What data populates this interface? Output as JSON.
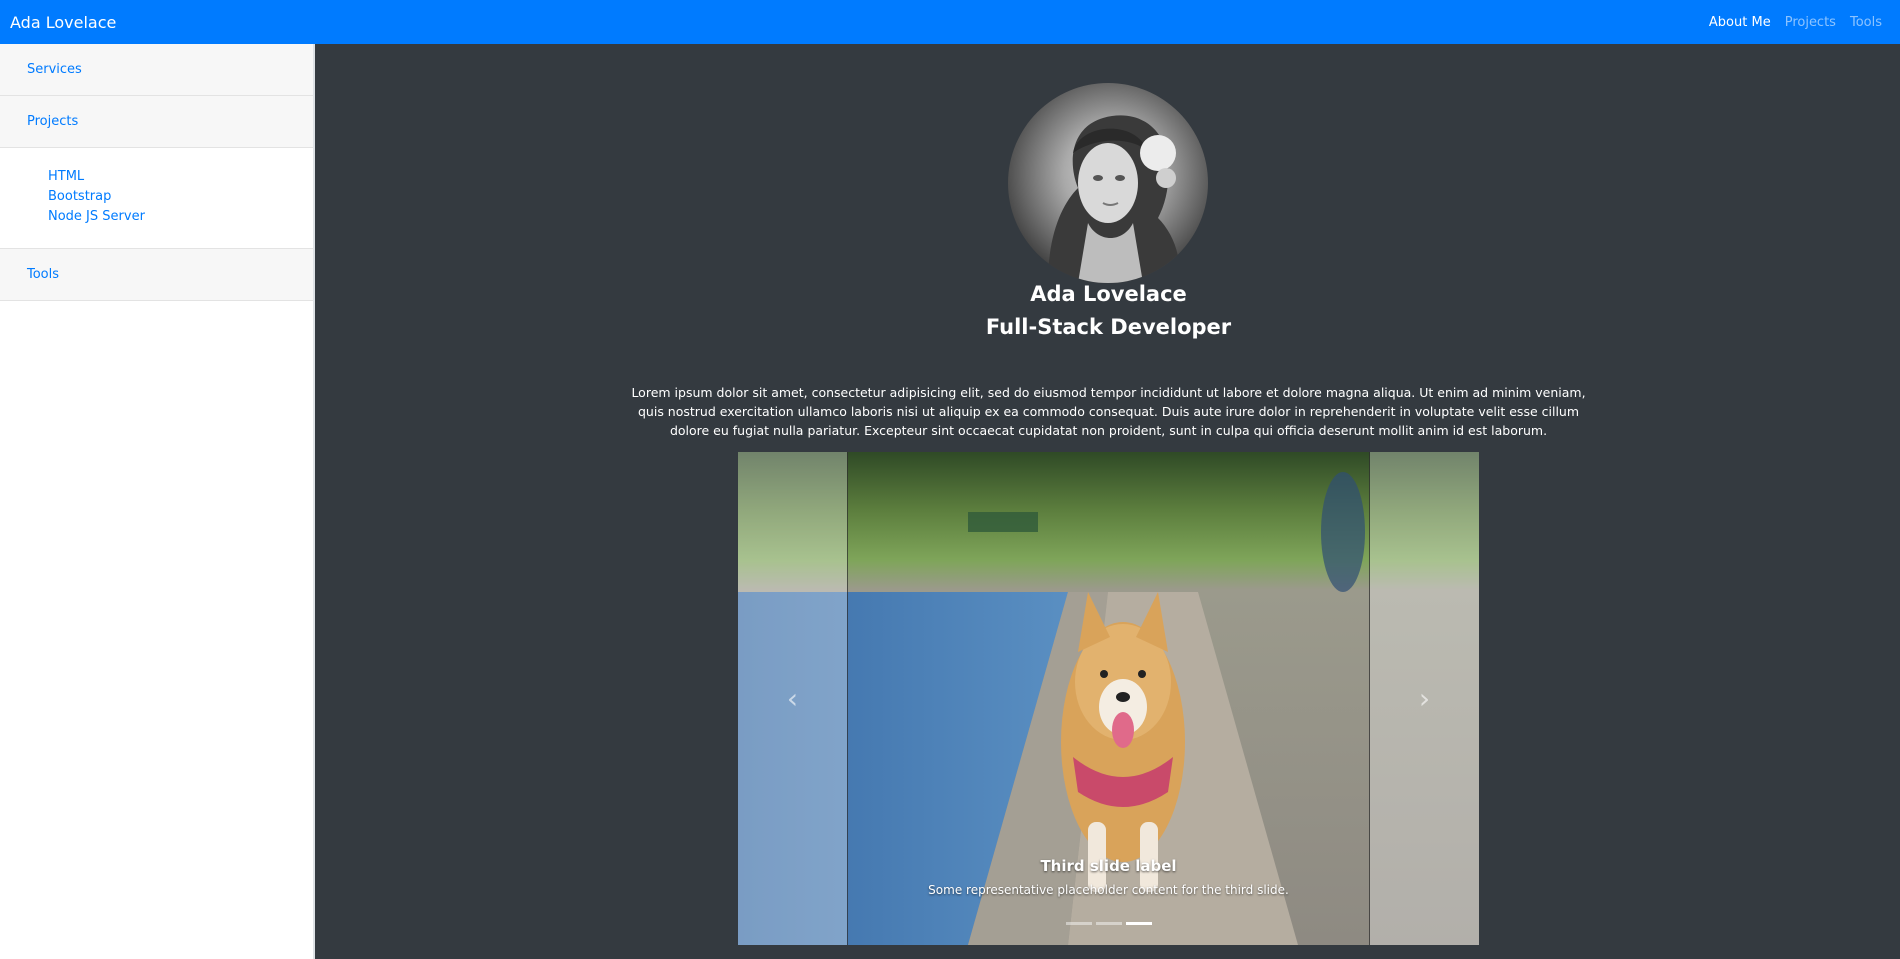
{
  "navbar": {
    "brand": "Ada Lovelace",
    "links": [
      {
        "label": "About Me",
        "active": true
      },
      {
        "label": "Projects",
        "active": false
      },
      {
        "label": "Tools",
        "active": false
      }
    ]
  },
  "sidebar": {
    "items": [
      "Services",
      "Projects",
      "Tools"
    ],
    "projects_sub": [
      "HTML",
      "Bootstrap",
      "Node JS Server"
    ]
  },
  "profile": {
    "name": "Ada Lovelace",
    "role": "Full-Stack Developer",
    "bio": "Lorem ipsum dolor sit amet, consectetur adipisicing elit, sed do eiusmod tempor incididunt ut labore et dolore magna aliqua. Ut enim ad minim veniam, quis nostrud exercitation ullamco laboris nisi ut aliquip ex ea commodo consequat. Duis aute irure dolor in reprehenderit in voluptate velit esse cillum dolore eu fugiat nulla pariatur. Excepteur sint occaecat cupidatat non proident, sunt in culpa qui officia deserunt mollit anim id est laborum."
  },
  "carousel": {
    "caption_title": "Third slide label",
    "caption_text": "Some representative placeholder content for the third slide.",
    "slide_count": 3,
    "active_index": 2,
    "prev_icon": "chevron-left-icon",
    "next_icon": "chevron-right-icon"
  },
  "colors": {
    "navbar": "#007bff",
    "background": "#343a40",
    "link": "#007bff"
  }
}
